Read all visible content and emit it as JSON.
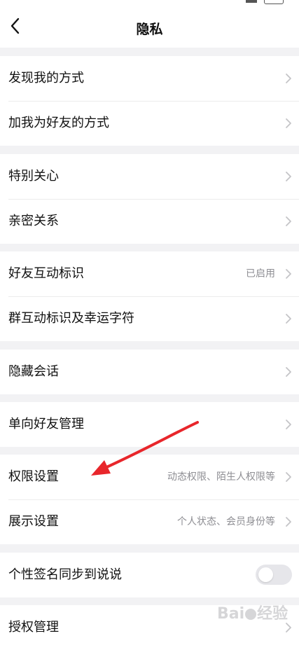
{
  "header": {
    "title": "隐私"
  },
  "groups": [
    {
      "items": [
        {
          "label": "发现我的方式"
        },
        {
          "label": "加我为好友的方式"
        }
      ]
    },
    {
      "items": [
        {
          "label": "特别关心"
        },
        {
          "label": "亲密关系"
        }
      ]
    },
    {
      "items": [
        {
          "label": "好友互动标识",
          "value": "已启用"
        },
        {
          "label": "群互动标识及幸运字符"
        }
      ]
    },
    {
      "items": [
        {
          "label": "隐藏会话"
        }
      ]
    },
    {
      "items": [
        {
          "label": "单向好友管理"
        }
      ]
    },
    {
      "items": [
        {
          "label": "权限设置",
          "value": "动态权限、陌生人权限等"
        },
        {
          "label": "展示设置",
          "value": "个人状态、会员身份等"
        }
      ]
    },
    {
      "items": [
        {
          "label": "个性签名同步到说说",
          "toggle": false
        }
      ]
    },
    {
      "items": [
        {
          "label": "授权管理"
        }
      ]
    }
  ],
  "annotation": {
    "color": "#e8262b"
  },
  "watermark": {
    "text_left": "Bai",
    "text_right": "经验"
  },
  "icons": {
    "back": "chevron-left-icon",
    "row_chevron": "chevron-right-icon"
  }
}
